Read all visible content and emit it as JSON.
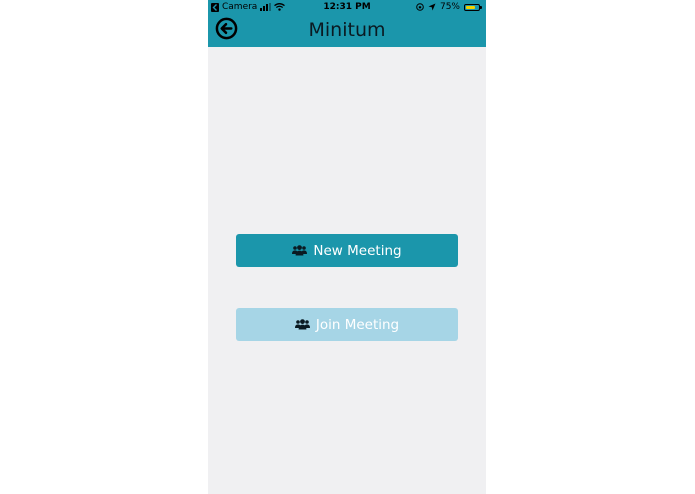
{
  "status_bar": {
    "back_app": "Camera",
    "time": "12:31 PM",
    "battery_percent": "75%",
    "battery_level": 0.75,
    "icons": [
      "back-arrow-icon",
      "signal-icon",
      "wifi-icon",
      "orientation-lock-icon",
      "location-icon",
      "battery-icon"
    ]
  },
  "header": {
    "title": "Minitum",
    "back_icon": "back-arrow-circle-icon"
  },
  "actions": {
    "new_meeting": {
      "label": "New Meeting",
      "icon": "users-icon"
    },
    "join_meeting": {
      "label": "Join Meeting",
      "icon": "users-icon"
    }
  },
  "colors": {
    "primary": "#1b96ab",
    "primary_light": "#a6d5e6",
    "background": "#f0f0f2",
    "battery": "#f2d100"
  }
}
